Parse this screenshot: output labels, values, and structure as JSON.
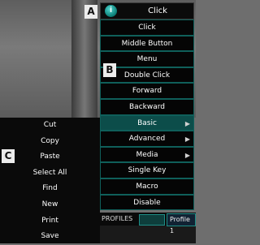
{
  "labels": {
    "a": "A",
    "b": "B",
    "c": "C"
  },
  "combo": {
    "info_glyph": "i",
    "value": "Click",
    "accent": "#0a7c74"
  },
  "menu_b": {
    "items": [
      {
        "label": "Click",
        "submenu": false
      },
      {
        "label": "Middle Button",
        "submenu": false
      },
      {
        "label": "Menu",
        "submenu": false
      },
      {
        "label": "Double Click",
        "submenu": false
      },
      {
        "label": "Forward",
        "submenu": false
      },
      {
        "label": "Backward",
        "submenu": false
      },
      {
        "label": "Basic",
        "submenu": true,
        "selected": true
      },
      {
        "label": "Advanced",
        "submenu": true
      },
      {
        "label": "Media",
        "submenu": true
      },
      {
        "label": "Single Key",
        "submenu": false
      },
      {
        "label": "Macro",
        "submenu": false
      },
      {
        "label": "Disable",
        "submenu": false
      }
    ],
    "submenu_arrow": "▶",
    "border_color": "#0f5f5a",
    "selected_color": "#0c4d4a"
  },
  "menu_c": {
    "items": [
      "Cut",
      "Copy",
      "Paste",
      "Select All",
      "Find",
      "New",
      "Print",
      "Save"
    ]
  },
  "profiles": {
    "label": "PROFILES",
    "profile_name": "Profile 1"
  }
}
